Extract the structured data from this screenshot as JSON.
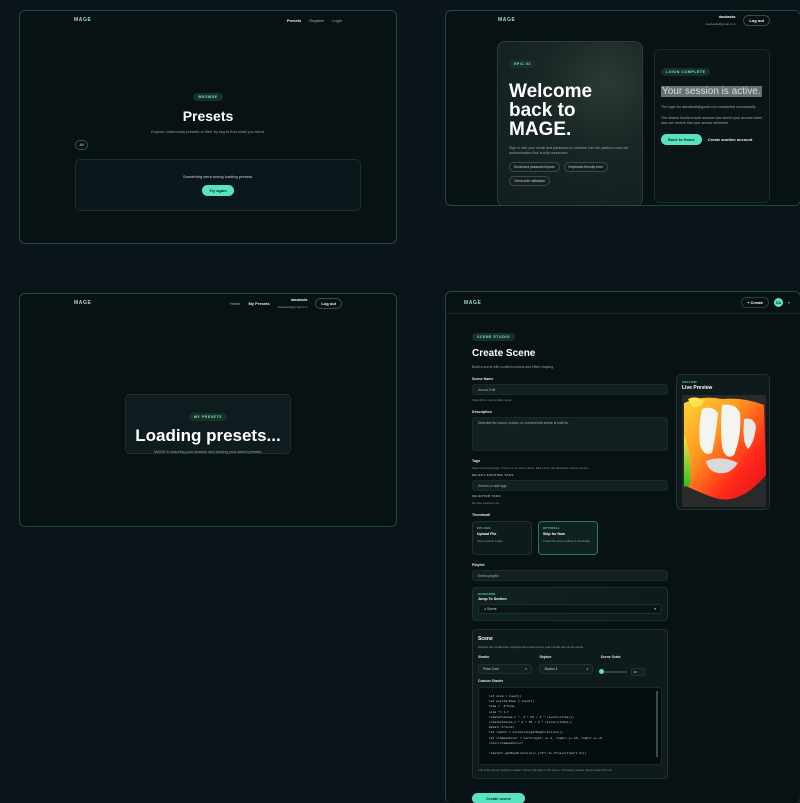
{
  "panel1": {
    "brand": "MAGE",
    "nav": [
      "Presets",
      "Register",
      "Login"
    ],
    "chip": "BROWSE",
    "title": "Presets",
    "subtitle": "Explore community presets or filter by tag to find what you need.",
    "filter_all": "All",
    "error_text": "Something went wrong loading presets.",
    "retry": "Try again"
  },
  "panel2": {
    "brand": "MAGE",
    "user_name": "dasdasda",
    "user_email": "dasdasda@gmail.com",
    "logout": "Log out",
    "chip": "EPIC 02",
    "headline": "Welcome back to MAGE.",
    "body": "Sign in with your email and password to continue into the platform once the authentication flow is fully connected.",
    "tags": [
      "Email and password inputs",
      "Keyboard-friendly form",
      "Client-side validation"
    ],
    "status_chip": "LOGIN COMPLETE",
    "status_title": "Your session is active.",
    "status_p1": "The login for dasdasda@gmail.com completed successfully.",
    "status_p2": "The shared frontend auth session has stored your access token and can restore this user across refreshes.",
    "back_home": "Back to Home",
    "another": "Create another account"
  },
  "panel3": {
    "brand": "MAGE",
    "nav": [
      "Home",
      "My Presets"
    ],
    "user_name": "dasdasda",
    "user_email": "dasdasda@gmail.com",
    "logout": "Log out",
    "chip": "MY PRESETS",
    "title": "Loading presets...",
    "subtitle": "MAGE is restoring your session and loading your saved presets."
  },
  "panel4": {
    "brand": "MAGE",
    "create": "+ Create",
    "avatar": "DA",
    "chip": "SCENE STUDIO",
    "title": "Create Scene",
    "subtitle": "Build a scene with curated controls and effect shaping.",
    "scene_name_label": "Scene Name",
    "scene_name_value": "Aurora Drift",
    "scene_name_hint": "Start with a memorable name.",
    "description_label": "Description",
    "description_placeholder": "Describe the mood, motion, or moment this scene is built for.",
    "tags_label": "Tags",
    "tags_hint": "Search existing tags. If there is no exact match, add it from the dropdown before saving.",
    "existing_tags_label": "SELECT EXISTING TAGS",
    "tags_placeholder": "Search or add tags",
    "selected_tags_label": "SELECTED TAGS",
    "selected_tags_value": "No tags selected yet.",
    "thumbnail_label": "Thumbnail",
    "thumb_upload_kind": "UPLOAD",
    "thumb_upload_title": "Upload File",
    "thumb_upload_desc": "Use a custom image.",
    "thumb_skip_kind": "OPTIONAL",
    "thumb_skip_title": "Skip for Now",
    "thumb_skip_desc": "Create the scene without a thumbnail.",
    "playlist_label": "Playlist",
    "playlist_value": "Select playlist",
    "nav_kind": "NAVIGATION",
    "nav_title": "Jump To Section",
    "nav_value": "Scene",
    "scene_title": "Scene",
    "scene_desc": "Choose the visual style, background environment, and overall size of the scene.",
    "shader_label": "Shader",
    "shader_value": "Prism Core",
    "skybox_label": "Skybox",
    "skybox_value": "Skybox 4",
    "scale_label": "Scene Scale",
    "scale_value": "16",
    "custom_shader_label": "Custom Shader",
    "code": "let size = input()\nlet pointerDown = input()\ntime = .3*time\nsize *= 1.7\nrotateY(mouse.x * -2 * PI / 2 * (1+nsin(time)))\nrotateX(mouse.y * 2 * PI / 2 * (1+nsin(time)))\nmetal(.5*size)\nlet rayDir = normalize(getRayDirection())\nlet clampedColor = vec3(rayDir.x+.2, rayDir.y+.25, rayDir.z+.2)\ncolor(clampedColor)\n\nrotateY(-getRayDirection().y*4*(.5+.5*nsin(time*1.5)))",
    "code_note": "This is the actual 'sculpture-shader' source that ships in the scene. Choosing a shader above swaps this text.",
    "submit": "Create scene",
    "preview_kind": "PREVIEW",
    "preview_title": "Live Preview"
  }
}
